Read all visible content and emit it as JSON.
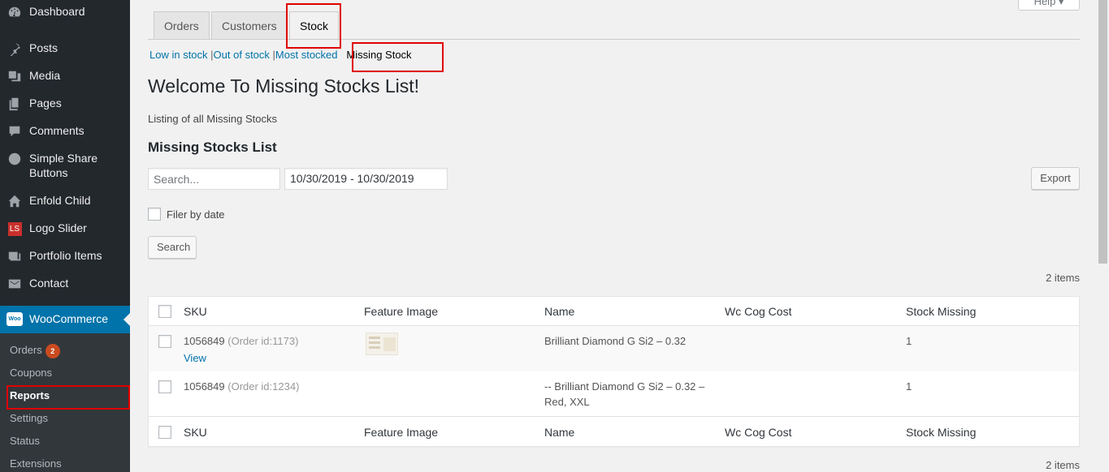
{
  "sidebar": {
    "items": [
      {
        "label": "Dashboard",
        "icon": "dashboard-icon"
      },
      {
        "label": "Posts",
        "icon": "pin-icon"
      },
      {
        "label": "Media",
        "icon": "media-icon"
      },
      {
        "label": "Pages",
        "icon": "pages-icon"
      },
      {
        "label": "Comments",
        "icon": "comment-icon"
      },
      {
        "label": "Simple Share Buttons",
        "icon": "share-icon"
      },
      {
        "label": "Enfold Child",
        "icon": "home-icon"
      },
      {
        "label": "Logo Slider",
        "icon": "ls-icon"
      },
      {
        "label": "Portfolio Items",
        "icon": "portfolio-icon"
      },
      {
        "label": "Contact",
        "icon": "mail-icon"
      }
    ],
    "woocommerce": {
      "label": "WooCommerce",
      "logo": "Woo"
    },
    "submenu": [
      {
        "label": "Orders",
        "badge": "2"
      },
      {
        "label": "Coupons"
      },
      {
        "label": "Reports"
      },
      {
        "label": "Settings"
      },
      {
        "label": "Status"
      },
      {
        "label": "Extensions"
      }
    ]
  },
  "header": {
    "help_label": "Help ▾",
    "tabs": [
      {
        "label": "Orders"
      },
      {
        "label": "Customers"
      },
      {
        "label": "Stock"
      }
    ]
  },
  "subnav": {
    "links": [
      "Low in stock",
      "Out of stock",
      "Most stocked"
    ],
    "current": "Missing Stock"
  },
  "main": {
    "title": "Welcome To Missing Stocks List!",
    "description": "Listing of all Missing Stocks",
    "list_title": "Missing Stocks List",
    "search_placeholder": "Search...",
    "date_range": "10/30/2019 - 10/30/2019",
    "export_label": "Export",
    "filter_label": "Filer by date",
    "search_button": "Search",
    "items_count": "2 items"
  },
  "table": {
    "columns": [
      "SKU",
      "Feature Image",
      "Name",
      "Wc Cog Cost",
      "Stock Missing"
    ],
    "rows": [
      {
        "sku": "1056849",
        "order": "(Order id:1173)",
        "view": "View",
        "name": "Brilliant Diamond G Si2 – 0.32",
        "name2": "",
        "cost": "",
        "missing": "1"
      },
      {
        "sku": "1056849",
        "order": "(Order id:1234)",
        "view": "",
        "name": "-- Brilliant Diamond G Si2 – 0.32 –",
        "name2": "Red, XXL",
        "cost": "",
        "missing": "1"
      }
    ]
  },
  "colors": {
    "sidebar_bg": "#23282d",
    "accent": "#0073aa",
    "highlight_box": "#e00000",
    "badge": "#ca4a1f"
  }
}
